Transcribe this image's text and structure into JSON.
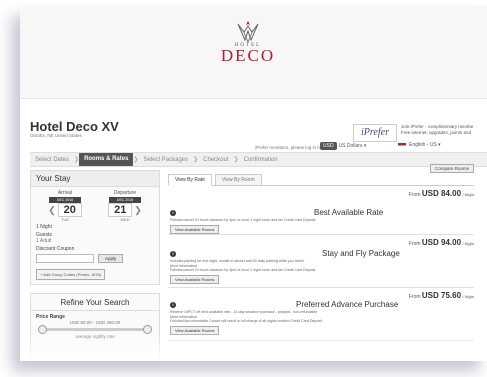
{
  "logo": {
    "hotel": "HOTEL",
    "deco": "DECO"
  },
  "iprefer": {
    "brand": "iPrefer",
    "line1": "Join iPrefer - complimentary membe",
    "line2": "Free internet, upgrades, points and"
  },
  "hotel": {
    "name": "Hotel Deco XV",
    "location": "Omaha, NE United States"
  },
  "header": {
    "login_text": "iPrefer members, please log in here.",
    "currency_badge": "USD",
    "currency": "US Dollars ▾",
    "language": "English - US ▾"
  },
  "steps": [
    "Select Dates",
    "Rooms & Rates",
    "Select Packages",
    "Checkout",
    "Confirmation"
  ],
  "stay": {
    "title": "Your Stay",
    "arrival_label": "Arrival",
    "departure_label": "Departure",
    "arrival_month": "DEC 2016",
    "departure_month": "DEC 2016",
    "arrival_day": "20",
    "departure_day": "21",
    "arrival_weekday": "TUE",
    "departure_weekday": "WED",
    "nights": "1 Night",
    "guests_label": "Guests",
    "guests_value": "1 Adult",
    "coupon_label": "Discount Coupon",
    "apply": "Apply",
    "add_codes": "+ Add Group Codes (Promo, IATA)"
  },
  "refine": {
    "title": "Refine Your Search",
    "price_label": "Price Range",
    "range": "USD 60.00 - USD 260.00",
    "avg": "average nightly rate"
  },
  "main": {
    "compare": "Compare Rooms",
    "tabs": [
      "View By Rate",
      "View By Room"
    ],
    "rates": [
      {
        "from": "From",
        "price": "USD 84.00",
        "per": "/ Night",
        "title": "Best Available Rate",
        "desc": "Policies:cancel 24 hours advance by 4pm or incur 1 night room and tax Credit Card Deposit",
        "desc2": "",
        "desc3": "",
        "button": "View Available Rooms"
      },
      {
        "from": "From",
        "price": "USD 94.00",
        "per": "/ Night",
        "title": "Stay and Fly Package",
        "desc": "Includes parking for first night, shuttle to airport and 90 daily parking while you travel.",
        "desc2": "More Information",
        "desc3": "Policies:cancel 24 hours advance by 4pm or incur 1 night room and tax Credit Card Deposit",
        "button": "View Available Rooms"
      },
      {
        "from": "From",
        "price": "USD 75.60",
        "per": "/ Night",
        "title": "Preferred Advance Purchase",
        "desc": "Receive 10PCT off best available rate - 14-day advance purchase - prepaid - non-refundable",
        "desc2": "More Information",
        "desc3": "Policies:Non-refundable  Cancel will result in full charge of all nights booked Credit Card Deposit",
        "button": "View Available Rooms"
      }
    ]
  },
  "colors": {
    "brand": "#b01e2f",
    "iprefer": "#5b3f77",
    "active_step": "#555555"
  }
}
